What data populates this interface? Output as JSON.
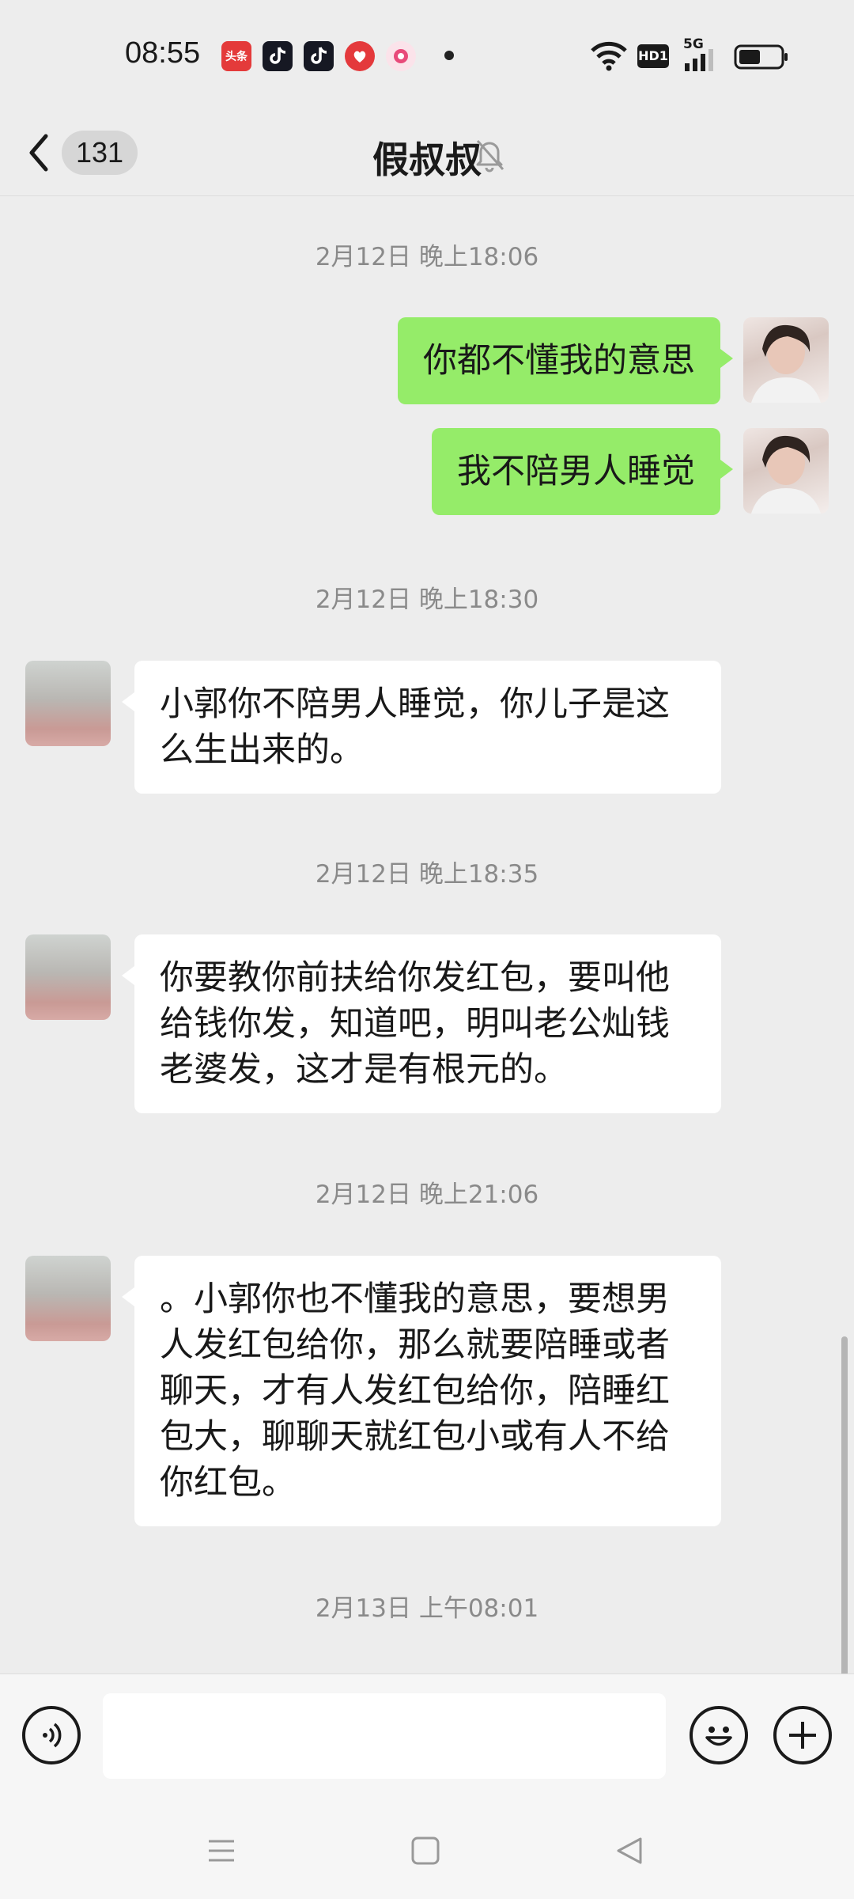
{
  "status_bar": {
    "time": "08:55",
    "apps": [
      {
        "name": "toutiao-app-icon",
        "label": "头条",
        "color": "#e43a3a"
      },
      {
        "name": "douyin-lite-app-icon",
        "label": "",
        "color": "#161823"
      },
      {
        "name": "douyin-app-icon",
        "label": "",
        "color": "#161823"
      },
      {
        "name": "red-circle-app-icon",
        "label": "",
        "color": "#e4393c"
      },
      {
        "name": "pink-app-icon",
        "label": "",
        "color": "#f4a0b5"
      }
    ],
    "hd_label": "HD1",
    "network_label": "5G"
  },
  "header": {
    "unread_count": "131",
    "title": "假叔叔"
  },
  "messages": [
    {
      "type": "timestamp",
      "text": "2月12日 晚上18:06"
    },
    {
      "type": "me",
      "text": "你都不懂我的意思"
    },
    {
      "type": "me",
      "text": "我不陪男人睡觉"
    },
    {
      "type": "timestamp",
      "text": "2月12日 晚上18:30"
    },
    {
      "type": "other",
      "lines": [
        "小郭你不陪男人睡觉，你儿子是这",
        "么生出来的。"
      ]
    },
    {
      "type": "timestamp",
      "text": "2月12日 晚上18:35"
    },
    {
      "type": "other",
      "lines": [
        "你要教你前扶给你发红包，要叫他",
        "给钱你发，知道吧，明叫老公灿钱",
        "老婆发，这才是有根元的。"
      ]
    },
    {
      "type": "timestamp",
      "text": "2月12日 晚上21:06"
    },
    {
      "type": "other",
      "lines": [
        "。小郭你也不懂我的意思，要想男",
        "人发红包给你，那么就要陪睡或者",
        "聊天，才有人发红包给你，陪睡红",
        "包大，聊聊天就红包小或有人不给",
        "你红包。"
      ]
    },
    {
      "type": "timestamp",
      "text": "2月13日 上午08:01"
    }
  ],
  "input": {
    "placeholder": ""
  },
  "colors": {
    "background": "#ededed",
    "my_bubble": "#95ec69",
    "other_bubble": "#ffffff",
    "timestamp": "#8a8a8a"
  }
}
